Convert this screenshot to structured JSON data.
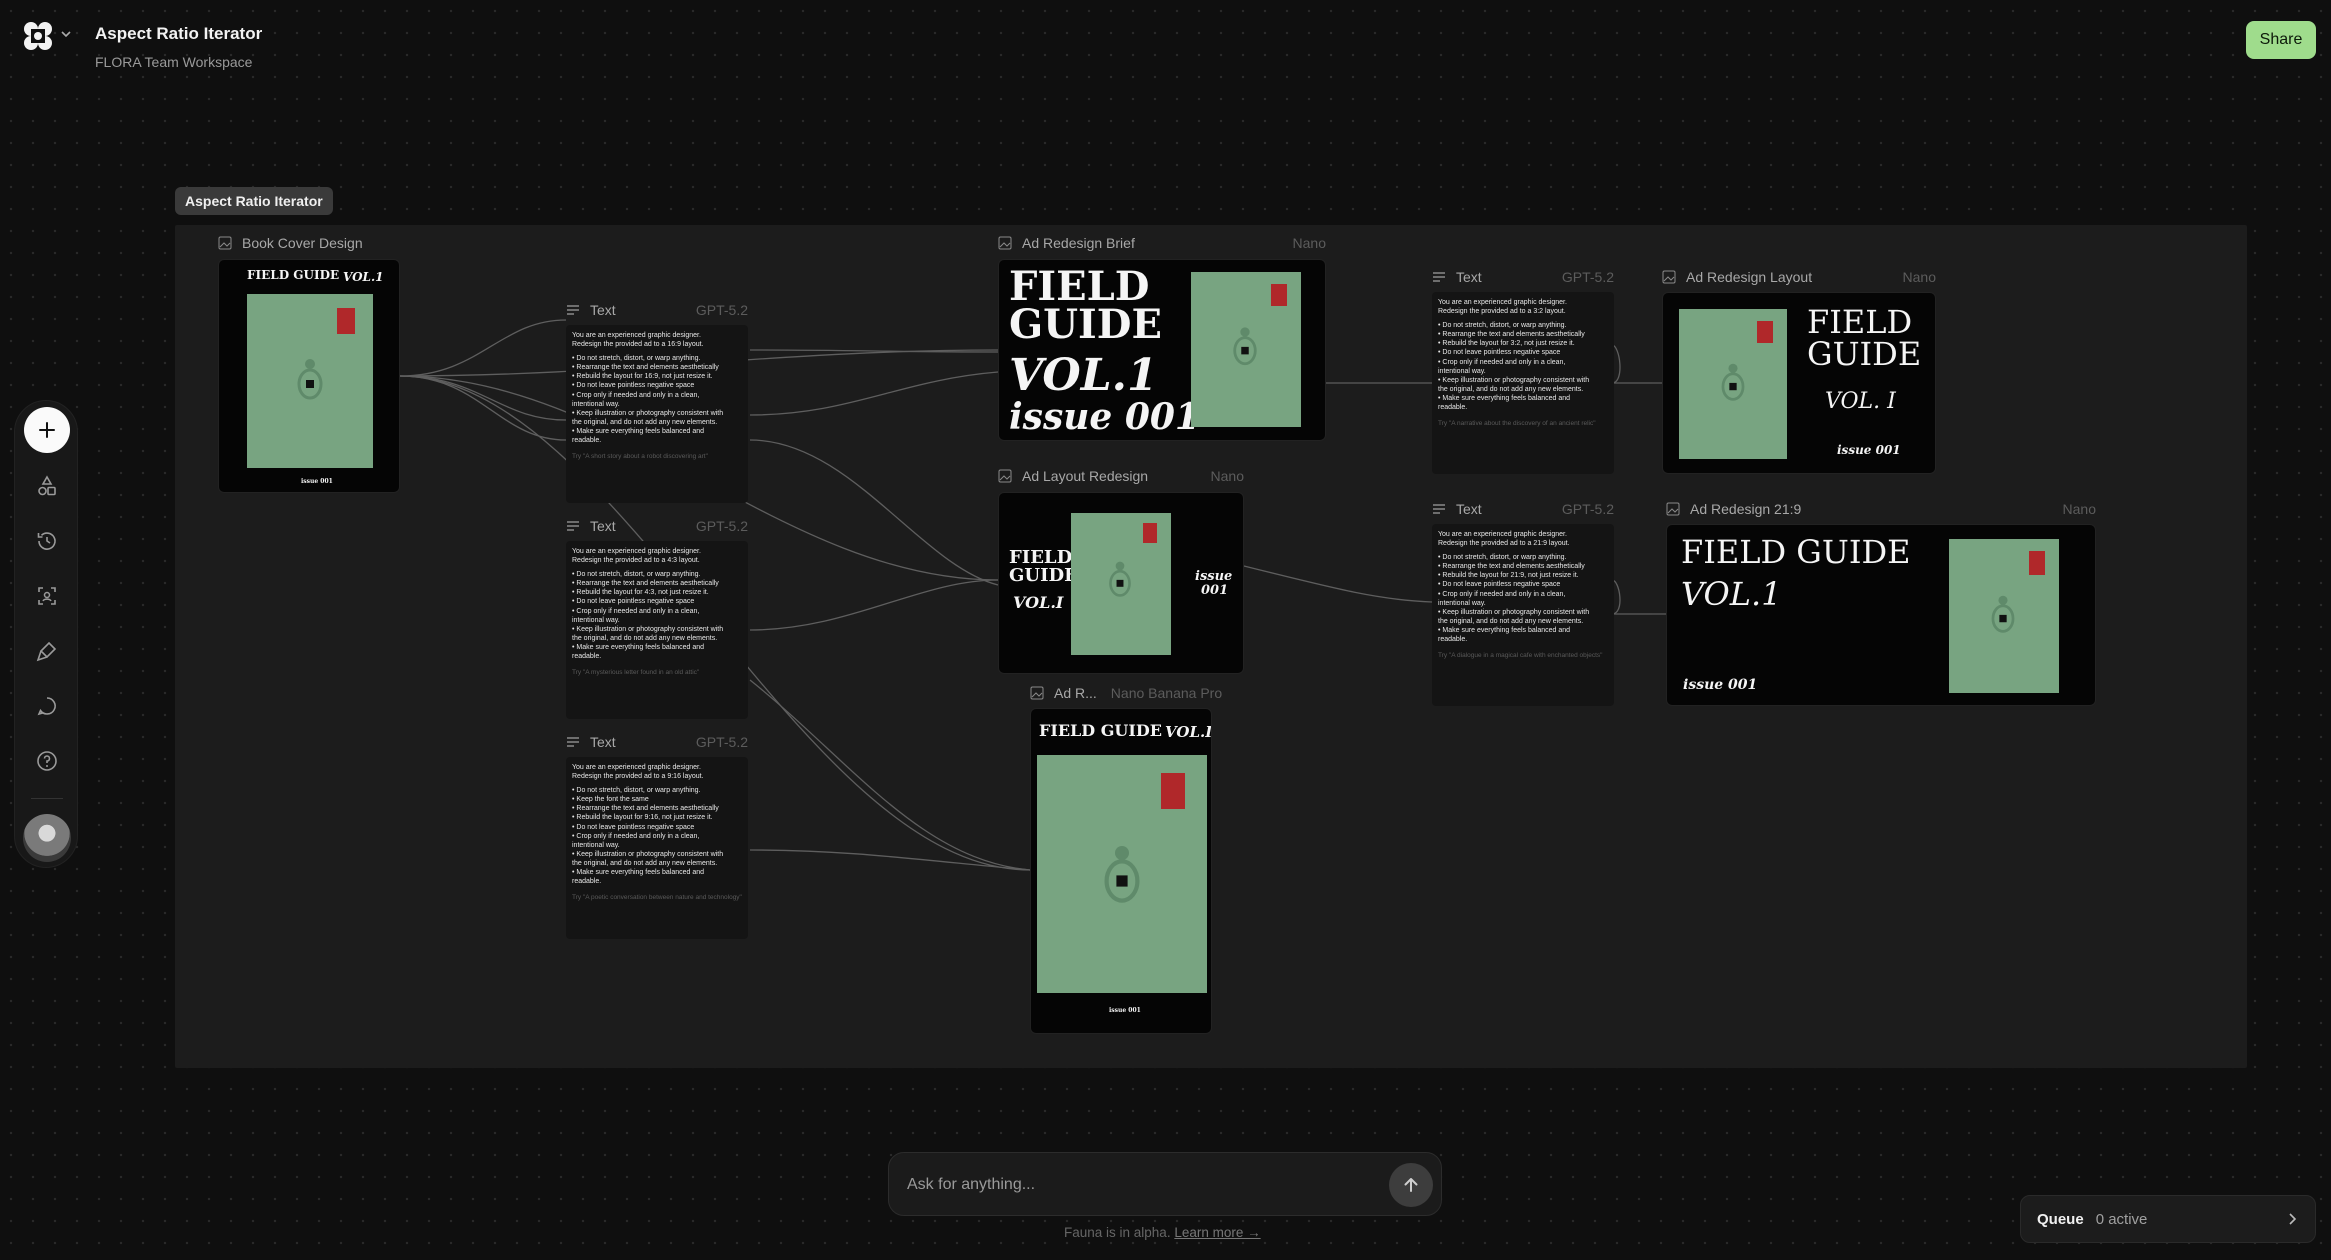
{
  "header": {
    "title": "Aspect Ratio Iterator",
    "workspace": "FLORA Team Workspace",
    "share_label": "Share"
  },
  "group": {
    "label": "Aspect Ratio Iterator"
  },
  "cover_text": {
    "field_guide": "FIELD GUIDE",
    "field": "FIELD",
    "guide": "GUIDE",
    "vol": "VOL.1",
    "vol_i": "VOL. I",
    "vol_slash": "VOL.I",
    "issue": "issue 001",
    "issue_word": "issue",
    "issue_num": "001"
  },
  "nodes": {
    "book_cover": {
      "title": "Book Cover Design"
    },
    "ad_brief": {
      "title": "Ad Redesign Brief",
      "model": "Nano"
    },
    "ad_layout_redesign": {
      "title": "Ad Layout Redesign",
      "model": "Nano"
    },
    "ad_r": {
      "title": "Ad R...",
      "model": "Nano Banana Pro"
    },
    "ad_layout": {
      "title": "Ad Redesign Layout",
      "model": "Nano"
    },
    "ad_21_9": {
      "title": "Ad Redesign 21:9",
      "model": "Nano"
    },
    "text_169": {
      "title": "Text",
      "model": "GPT-5.2",
      "intro": [
        "You are an experienced graphic designer.",
        "Redesign the provided ad to a 16:9 layout."
      ],
      "bullets": [
        "• Do not stretch, distort, or warp anything.",
        "• Rearrange the text and elements aesthetically",
        "• Rebuild the layout for 16:9, not just resize it.",
        "• Do not leave pointless negative space",
        "• Crop only if needed and only in a clean,",
        "intentional way.",
        "• Keep illustration or photography consistent with",
        "the original, and do not add any new elements.",
        "• Make sure everything feels balanced and",
        "readable."
      ],
      "try": "Try \"A short story about a robot discovering art\""
    },
    "text_43": {
      "title": "Text",
      "model": "GPT-5.2",
      "intro": [
        "You are an experienced graphic designer.",
        "Redesign the provided ad to a 4:3 layout."
      ],
      "bullets": [
        "• Do not stretch, distort, or warp anything.",
        "• Rearrange the text and elements aesthetically",
        "• Rebuild the layout for 4:3, not just resize it.",
        "• Do not leave pointless negative space",
        "• Crop only if needed and only in a clean,",
        "intentional way.",
        "• Keep illustration or photography consistent with",
        "the original, and do not add any new elements.",
        "• Make sure everything feels balanced and",
        "readable."
      ],
      "try": "Try \"A mysterious letter found in an old attic\""
    },
    "text_916": {
      "title": "Text",
      "model": "GPT-5.2",
      "intro": [
        "You are an experienced graphic designer.",
        "Redesign the provided ad to a 9:16 layout."
      ],
      "bullets": [
        "• Do not stretch, distort, or warp anything.",
        "• Keep the font the same",
        "• Rearrange the text and elements aesthetically",
        "• Rebuild the layout for 9:16, not just resize it.",
        "• Do not leave pointless negative space",
        "• Crop only if needed and only in a clean,",
        "intentional way.",
        "• Keep illustration or photography consistent with",
        "the original, and do not add any new elements.",
        "• Make sure everything feels balanced and",
        "readable."
      ],
      "try": "Try \"A poetic conversation between nature and technology\""
    },
    "text_32": {
      "title": "Text",
      "model": "GPT-5.2",
      "intro": [
        "You are an experienced graphic designer.",
        "Redesign the provided ad to a 3:2 layout."
      ],
      "bullets": [
        "• Do not stretch, distort, or warp anything.",
        "• Rearrange the text and elements aesthetically",
        "• Rebuild the layout for 3:2, not just resize it.",
        "• Do not leave pointless negative space",
        "• Crop only if needed and only in a clean,",
        "intentional way.",
        "• Keep illustration or photography consistent with",
        "the original, and do not add any new elements.",
        "• Make sure everything feels balanced and",
        "readable."
      ],
      "try": "Try \"A narrative about the discovery of an ancient relic\""
    },
    "text_219": {
      "title": "Text",
      "model": "GPT-5.2",
      "intro": [
        "You are an experienced graphic designer.",
        "Redesign the provided ad to a 21:9 layout."
      ],
      "bullets": [
        "• Do not stretch, distort, or warp anything.",
        "• Rearrange the text and elements aesthetically",
        "• Rebuild the layout for 21:9, not just resize it.",
        "• Do not leave pointless negative space",
        "• Crop only if needed and only in a clean,",
        "intentional way.",
        "• Keep illustration or photography consistent with",
        "the original, and do not add any new elements.",
        "• Make sure everything feels balanced and",
        "readable."
      ],
      "try": "Try \"A dialogue in a magical cafe with enchanted objects\""
    }
  },
  "sidebar": {
    "icons": [
      "add-icon",
      "shapes-icon",
      "history-icon",
      "scan-icon",
      "brush-icon",
      "chat-icon",
      "help-icon"
    ]
  },
  "prompt": {
    "placeholder": "Ask for anything...",
    "alpha_text": "Fauna is in alpha.",
    "learn_more": "Learn more →"
  },
  "queue": {
    "label": "Queue",
    "count": "0 active"
  },
  "colors": {
    "accent": "#9fdc8c",
    "book_green": "#78a481",
    "book_red": "#b0282a"
  }
}
